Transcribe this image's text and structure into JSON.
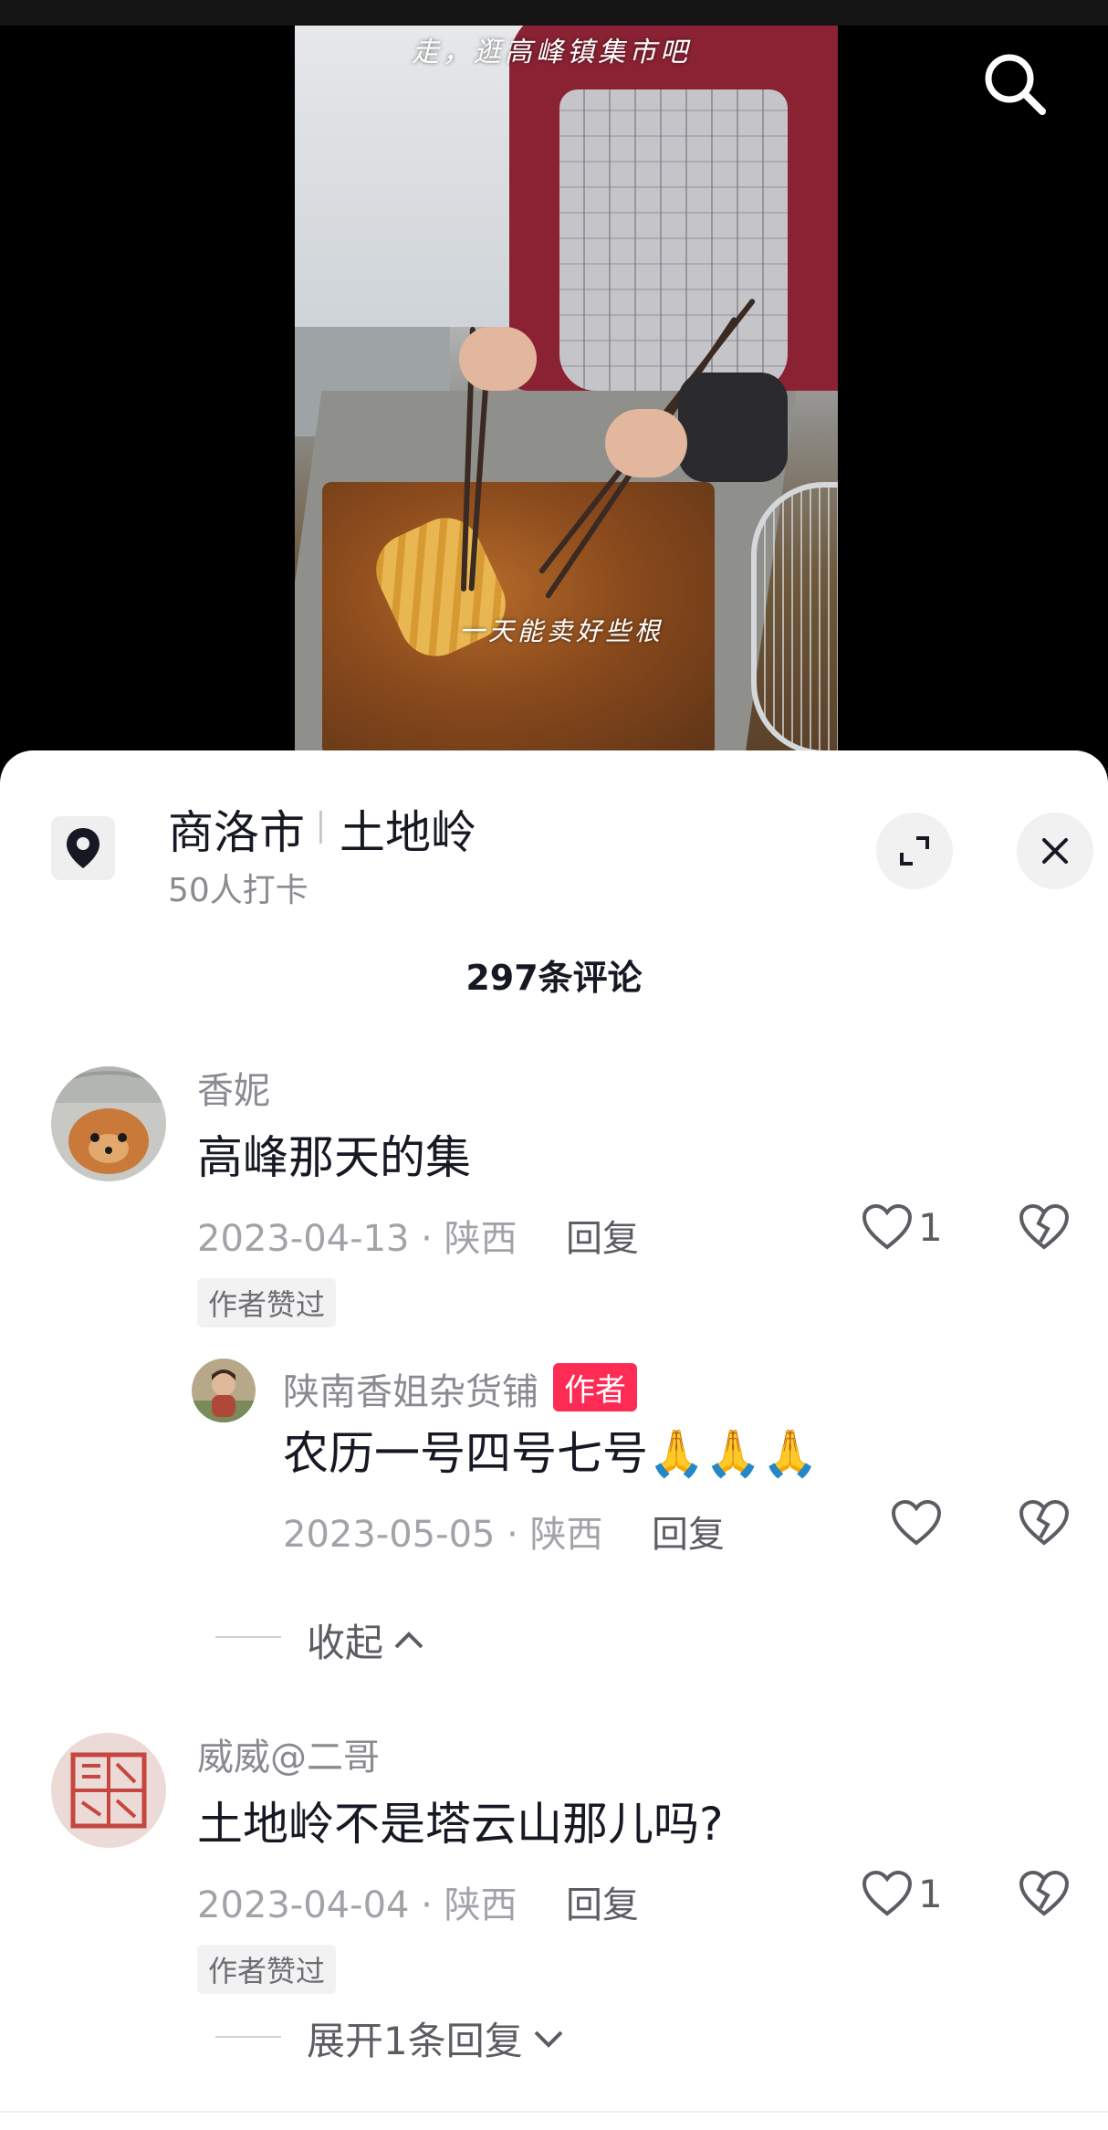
{
  "video": {
    "caption_top": "走，逛高峰镇集市吧",
    "caption_mid": "一天能卖好些根"
  },
  "location": {
    "city": "商洛市",
    "place": "土地岭",
    "checkin": "50人打卡"
  },
  "comments_header": {
    "count_label": "297条评论"
  },
  "comments": [
    {
      "user": "香妮",
      "text": "高峰那天的集",
      "date_region": "2023-04-13 · 陕西",
      "reply_label": "回复",
      "likes": "1",
      "author_liked_label": "作者赞过",
      "reply": {
        "user": "陕南香姐杂货铺",
        "author_badge": "作者",
        "text": "农历一号四号七号🙏🙏🙏",
        "date_region": "2023-05-05 · 陕西",
        "reply_label": "回复"
      },
      "collapse_label": "收起"
    },
    {
      "user": "威威@二哥",
      "text": "土地岭不是塔云山那儿吗?",
      "date_region": "2023-04-04 · 陕西",
      "reply_label": "回复",
      "likes": "1",
      "author_liked_label": "作者赞过",
      "expand_label": "展开1条回复"
    }
  ],
  "icons": {
    "search": "search-icon",
    "location": "location-pin-icon",
    "expand": "expand-icon",
    "close": "close-icon",
    "like": "heart-icon",
    "dislike": "broken-heart-icon"
  },
  "colors": {
    "accent": "#fe2c55",
    "text_primary": "#161823",
    "text_secondary": "#8a8b91"
  }
}
